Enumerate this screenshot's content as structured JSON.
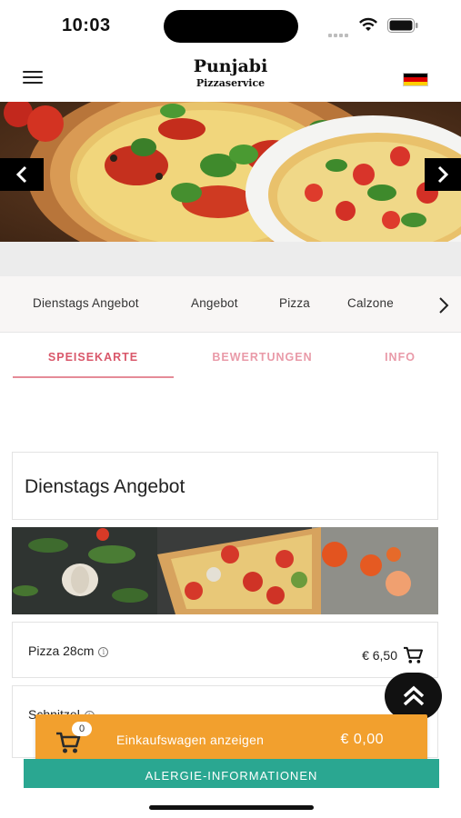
{
  "status_bar": {
    "time": "10:03"
  },
  "header": {
    "title": "Punjabi",
    "subtitle": "Pizzaservice",
    "menu_icon": "hamburger-menu-icon",
    "language_flag": "german-flag-icon"
  },
  "hero": {
    "prev_icon": "chevron-left-icon",
    "next_icon": "chevron-right-icon"
  },
  "categories": [
    "Dienstags Angebot",
    "Angebot",
    "Pizza",
    "Calzone"
  ],
  "tabs": [
    "SPEISEKARTE",
    "BEWERTUNGEN",
    "INFO"
  ],
  "section": {
    "title": "Dienstags Angebot"
  },
  "items": [
    {
      "name": "Pizza 28cm",
      "price": "€ 6,50"
    },
    {
      "name": "Schnitzel",
      "price": ""
    }
  ],
  "cart": {
    "count": "0",
    "label": "Einkaufswagen anzeigen",
    "total": "€ 0,00"
  },
  "allergy_button": "ALERGIE-INFORMATIONEN",
  "colors": {
    "tab_active": "#d9576a",
    "tab_inactive": "#e99aa8",
    "cart_bar": "#f2a02e",
    "allergy_button": "#2aa791"
  }
}
